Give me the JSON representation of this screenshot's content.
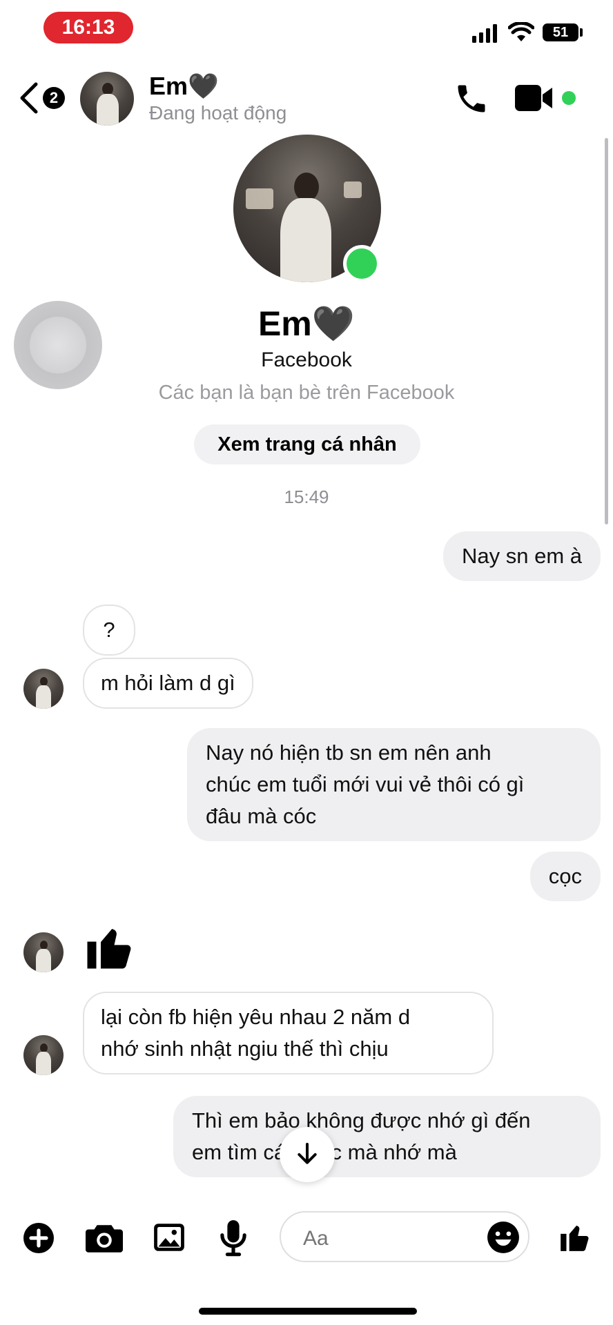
{
  "status_bar": {
    "time": "16:13",
    "battery": "51"
  },
  "header": {
    "back_badge": "2",
    "name": "Em🖤",
    "status": "Đang hoạt động"
  },
  "profile": {
    "name": "Em🖤",
    "subtitle": "Facebook",
    "friends_text": "Các bạn là bạn bè trên Facebook",
    "view_profile_label": "Xem trang cá nhân"
  },
  "conversation": {
    "timestamp": "15:49",
    "messages": [
      {
        "from": "me",
        "text": "Nay sn em à"
      },
      {
        "from": "them",
        "text": "?"
      },
      {
        "from": "them",
        "text": "m hỏi làm d gì"
      },
      {
        "from": "me",
        "lines": [
          "Nay nó hiện tb sn em nên anh",
          "chúc em tuổi mới vui vẻ thôi có gì",
          "đâu mà cóc"
        ]
      },
      {
        "from": "me",
        "text": "cọc"
      },
      {
        "from": "them",
        "type": "like"
      },
      {
        "from": "them",
        "lines": [
          "lại còn fb hiện yêu nhau 2 năm  d",
          "nhớ sinh nhật ngiu thế thì chịu"
        ]
      },
      {
        "from": "me",
        "lines": [
          "Thì em bảo không được nhớ gì đến",
          "em tìm cái khác mà nhớ mà"
        ]
      }
    ]
  },
  "composer": {
    "placeholder": "Aa"
  },
  "colors": {
    "online": "#31d158",
    "status_time_bg": "#e0262e",
    "bubble_out": "#efeff1"
  }
}
